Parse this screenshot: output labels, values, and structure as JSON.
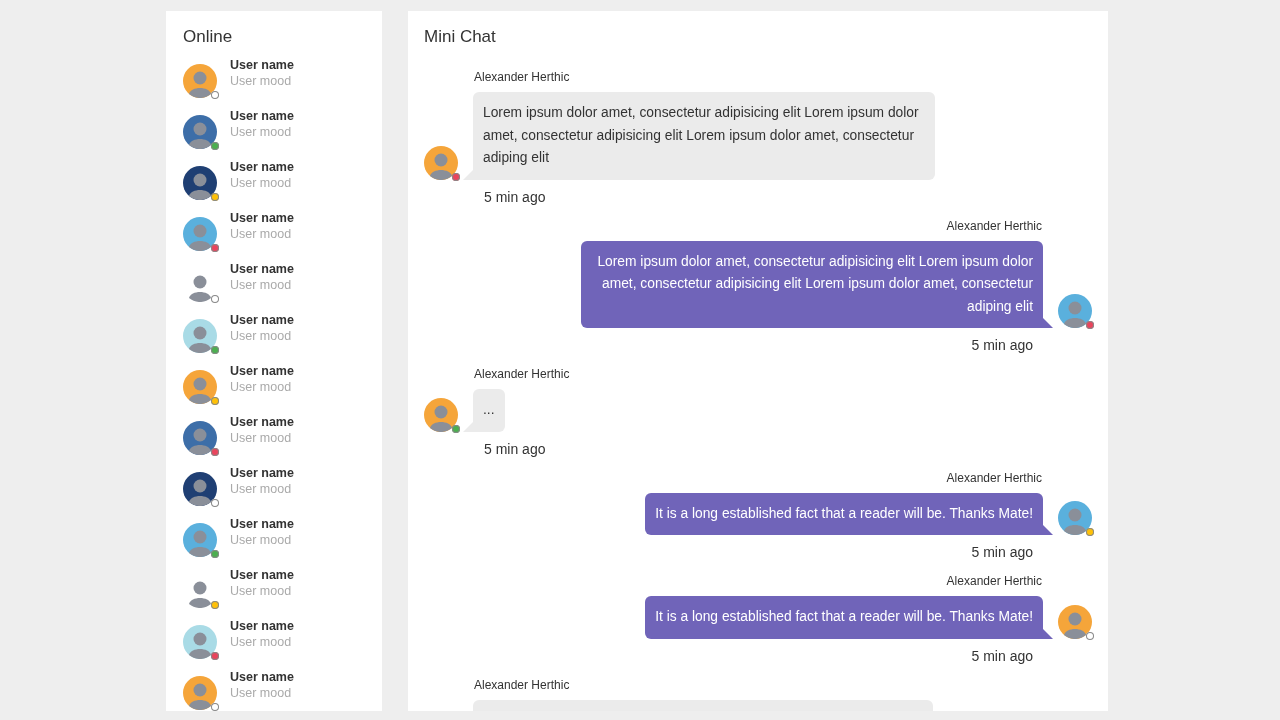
{
  "sidebar": {
    "title": "Online",
    "users": [
      {
        "name": "User name",
        "mood": "User mood",
        "color": "#ffffff"
      },
      {
        "name": "User name",
        "mood": "User mood",
        "color": "#4caf50"
      },
      {
        "name": "User name",
        "mood": "User mood",
        "color": "#ffc107"
      },
      {
        "name": "User name",
        "mood": "User mood",
        "color": "#e8455d"
      },
      {
        "name": "User name",
        "mood": "User mood",
        "color": "#ffffff"
      },
      {
        "name": "User name",
        "mood": "User mood",
        "color": "#4caf50"
      },
      {
        "name": "User name",
        "mood": "User mood",
        "color": "#ffc107"
      },
      {
        "name": "User name",
        "mood": "User mood",
        "color": "#e8455d"
      },
      {
        "name": "User name",
        "mood": "User mood",
        "color": "#ffffff"
      },
      {
        "name": "User name",
        "mood": "User mood",
        "color": "#4caf50"
      },
      {
        "name": "User name",
        "mood": "User mood",
        "color": "#ffc107"
      },
      {
        "name": "User name",
        "mood": "User mood",
        "color": "#e8455d"
      },
      {
        "name": "User name",
        "mood": "User mood",
        "color": "#ffffff"
      }
    ]
  },
  "chat": {
    "title": "Mini Chat",
    "messages": [
      {
        "kind": "received",
        "author": "Alexander Herthic",
        "text": "Lorem ipsum dolor amet, consectetur adipisicing elit Lorem ipsum dolor amet, consectetur adipisicing elit Lorem ipsum dolor amet, consectetur adiping elit",
        "time": "5 min ago",
        "color": "#e8455d"
      },
      {
        "kind": "sent",
        "author": "Alexander Herthic",
        "text": "Lorem ipsum dolor amet, consectetur adipisicing elit Lorem ipsum dolor amet, consectetur adipisicing elit Lorem ipsum dolor amet, consectetur adiping elit",
        "time": "5 min ago",
        "color": "#e8455d"
      },
      {
        "kind": "received",
        "author": "Alexander Herthic",
        "text": "...",
        "time": "5 min ago",
        "color": "#4caf50"
      },
      {
        "kind": "sent",
        "author": "Alexander Herthic",
        "text": "It is a long established fact that a reader will be. Thanks Mate!",
        "time": "5 min ago",
        "color": "#ffc107"
      },
      {
        "kind": "sent",
        "author": "Alexander Herthic",
        "text": "It is a long established fact that a reader will be. Thanks Mate!",
        "time": "5 min ago",
        "color": "#ffffff"
      },
      {
        "kind": "received",
        "author": "Alexander Herthic"
      }
    ]
  }
}
